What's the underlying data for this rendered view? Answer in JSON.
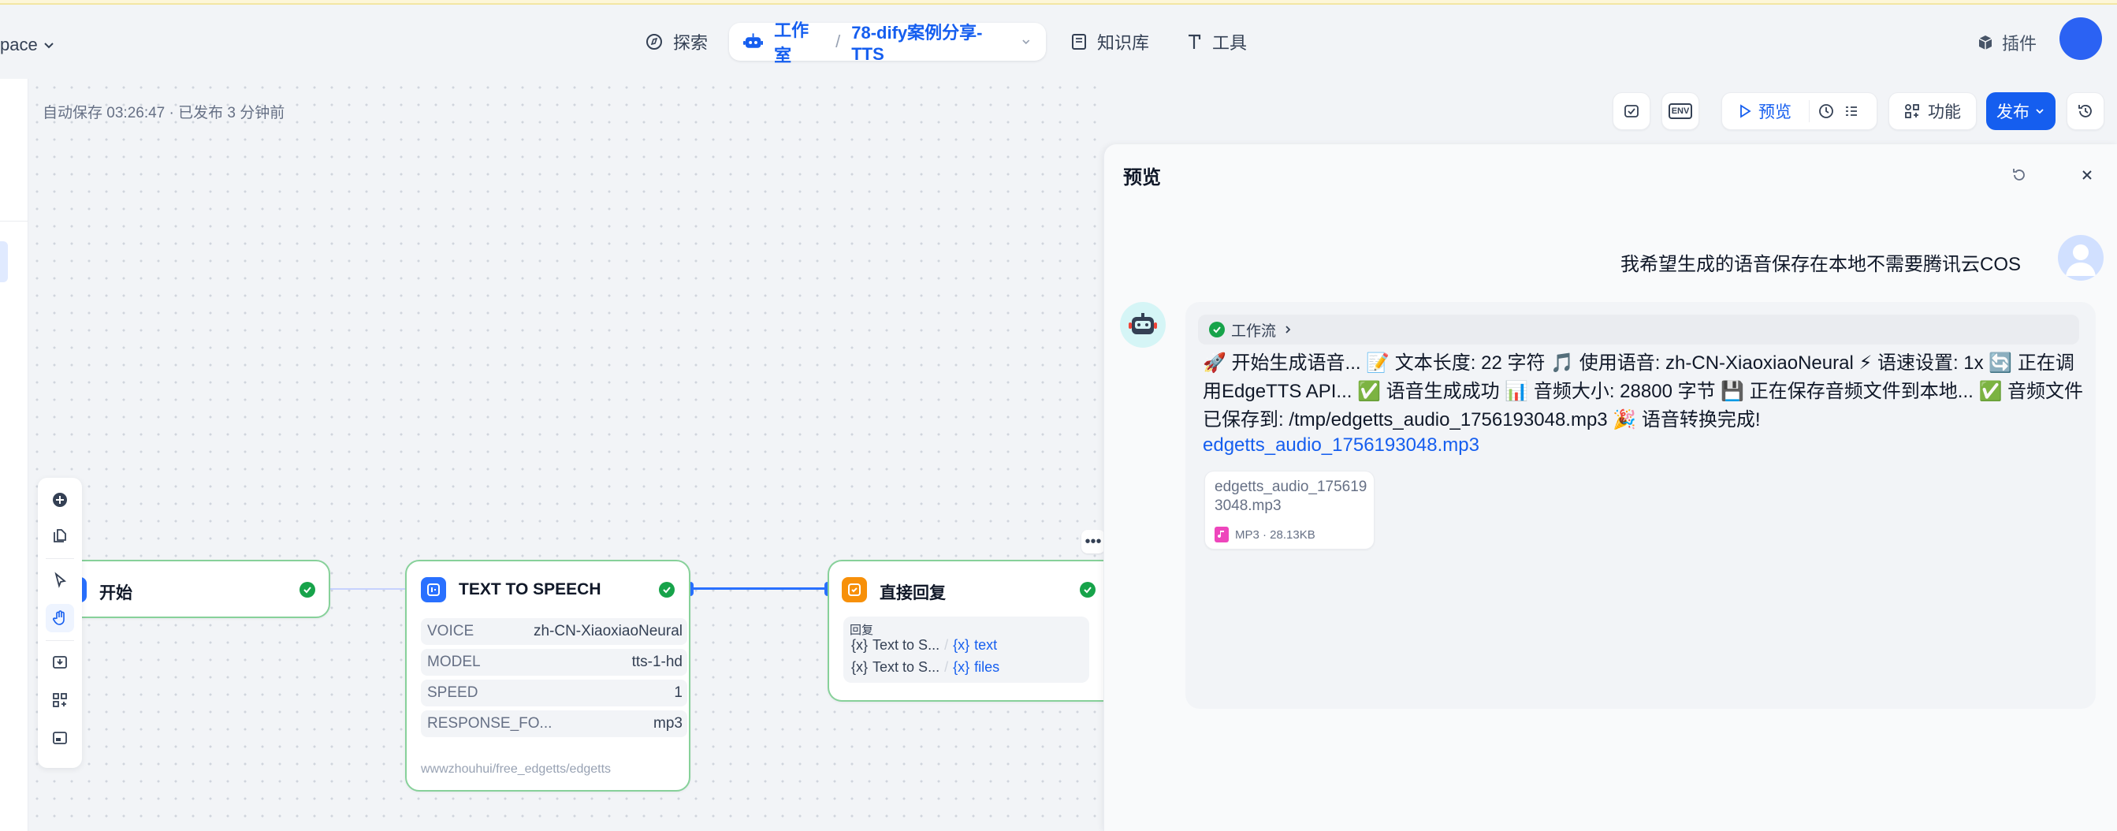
{
  "header": {
    "workspace_label": "pace",
    "nav": {
      "explore": "探索",
      "studio": "工作室",
      "app_name": "78-dify案例分享-TTS",
      "knowledge": "知识库",
      "tools": "工具"
    },
    "plugins": "插件"
  },
  "canvas": {
    "autosave_status": "自动保存 03:26:47 · 已发布 3 分钟前"
  },
  "toolbar": {
    "env_label": "ENV",
    "preview_label": "预览",
    "features_label": "功能",
    "publish_label": "发布"
  },
  "nodes": {
    "start": {
      "title": "开始"
    },
    "tts": {
      "title": "TEXT TO SPEECH",
      "params": [
        {
          "key": "VOICE",
          "value": "zh-CN-XiaoxiaoNeural"
        },
        {
          "key": "MODEL",
          "value": "tts-1-hd"
        },
        {
          "key": "SPEED",
          "value": "1"
        },
        {
          "key": "RESPONSE_FO...",
          "value": "mp3"
        }
      ],
      "footer": "wwwzhouhui/free_edgetts/edgetts"
    },
    "reply": {
      "title": "直接回复",
      "section_label": "回复",
      "vars": [
        {
          "source": "Text to S...",
          "name": "text"
        },
        {
          "source": "Text to S...",
          "name": "files"
        }
      ]
    }
  },
  "preview": {
    "title": "预览",
    "user_message": "我希望生成的语音保存在本地不需要腾讯云COS",
    "workflow_chip": "工作流",
    "bot_message": "🚀 开始生成语音... 📝 文本长度: 22 字符 🎵 使用语音: zh-CN-XiaoxiaoNeural ⚡ 语速设置: 1x 🔄 正在调用EdgeTTS API... ✅ 语音生成成功 📊 音频大小: 28800 字节 💾 正在保存音频文件到本地... ✅ 音频文件已保存到: /tmp/edgetts_audio_1756193048.mp3 🎉 语音转换完成!",
    "link_text": "edgetts_audio_1756193048.mp3",
    "file": {
      "name": "edgetts_audio_1756193048.mp3",
      "meta": "MP3 · 28.13KB"
    }
  },
  "colors": {
    "accent": "#155eef",
    "success": "#17a34a",
    "node_border": "#87d19a"
  }
}
